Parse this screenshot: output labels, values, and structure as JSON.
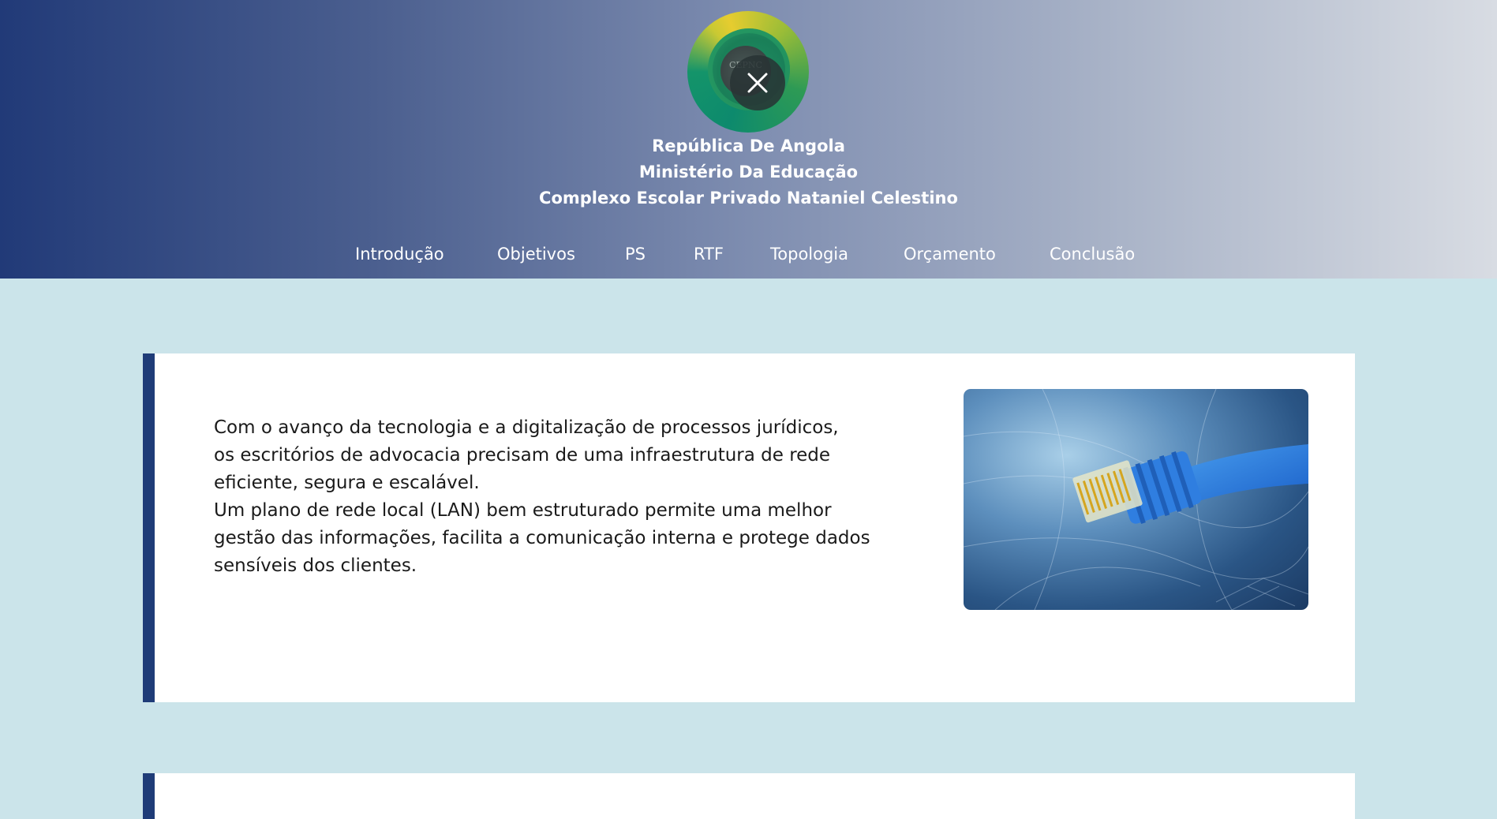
{
  "header": {
    "logo_icon": "school-emblem-logo",
    "logo_text": "CEPNC",
    "close_icon": "close-icon",
    "titles": [
      "República De Angola",
      "Ministério Da Educação",
      "Complexo Escolar Privado Nataniel Celestino"
    ]
  },
  "nav": {
    "items": [
      {
        "label": "Introdução"
      },
      {
        "label": "Objetivos"
      },
      {
        "label": "PS"
      },
      {
        "label": "RTF"
      },
      {
        "label": "Topologia"
      },
      {
        "label": "Orçamento"
      },
      {
        "label": "Conclusão"
      }
    ]
  },
  "intro": {
    "lines": [
      "Com o avanço da tecnologia e a digitalização de processos jurídicos,",
      "os escritórios de advocacia precisam de uma infraestrutura de rede",
      "eficiente, segura e escalável.",
      "Um plano de rede local (LAN) bem estruturado permite uma melhor",
      "gestão das informações, facilita a comunicação interna e protege dados",
      "sensíveis dos clientes."
    ],
    "image_icon": "network-cable-image"
  },
  "colors": {
    "accent": "#1f3c78",
    "page_bg": "#cbe4ea",
    "card_bg": "#ffffff"
  }
}
